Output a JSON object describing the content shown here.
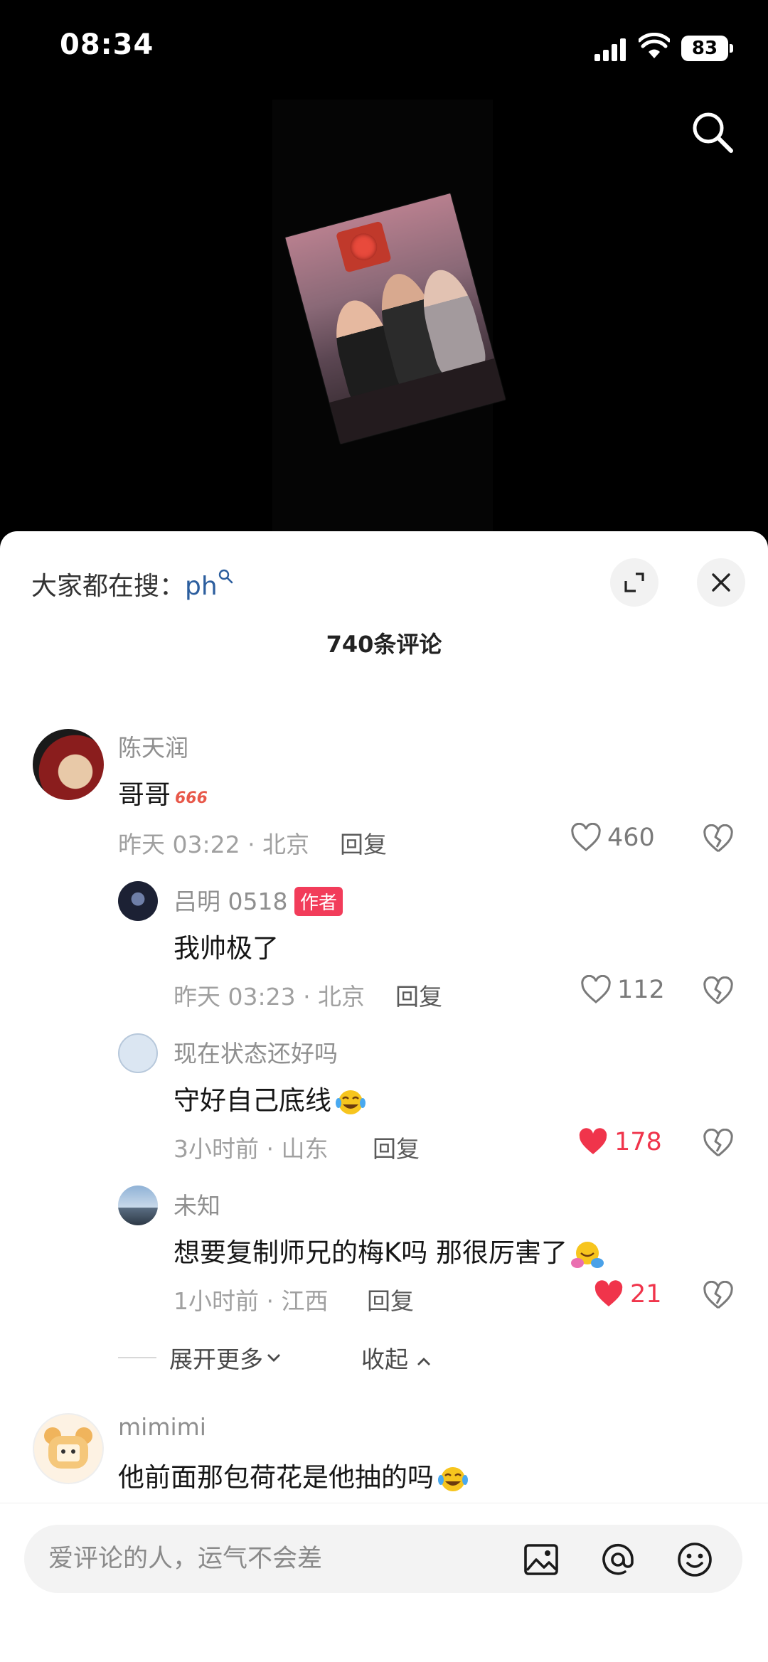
{
  "status_bar": {
    "time": "08:34",
    "battery": "83"
  },
  "hot_search": {
    "label": "大家都在搜：",
    "keyword": "ph"
  },
  "comment_count": "740条评论",
  "comments": [
    {
      "user": "陈天润",
      "text": "哥哥",
      "time_location": "昨天 03:22 · 北京",
      "reply_label": "回复",
      "likes": "460",
      "liked": false
    },
    {
      "user": "吕明 0518",
      "badge": "作者",
      "text": "我帅极了",
      "time_location": "昨天 03:23 · 北京",
      "reply_label": "回复",
      "likes": "112",
      "liked": false
    },
    {
      "user": "现在状态还好吗",
      "text": "守好自己底线",
      "time_location": "3小时前 · 山东",
      "reply_label": "回复",
      "likes": "178",
      "liked": true
    },
    {
      "user": "未知",
      "text": "想要复制师兄的梅K吗 那很厉害了",
      "time_location": "1小时前 · 江西",
      "reply_label": "回复",
      "likes": "21",
      "liked": true
    },
    {
      "user": "mimimi",
      "text": "他前面那包荷花是他抽的吗"
    }
  ],
  "expand_more": "展开更多",
  "collapse": "收起",
  "input": {
    "placeholder": "爱评论的人，运气不会差"
  },
  "icons": {
    "search": "search-icon",
    "expand": "expand-icon",
    "close": "close-icon",
    "image": "image-icon",
    "at": "at-icon",
    "emoji": "emoji-icon",
    "heart": "heart-icon",
    "dislike": "broken-heart-icon"
  },
  "colors": {
    "like_red": "#f0344b",
    "author_badge": "#f23c5a",
    "keyword_blue": "#2c5e9e"
  }
}
